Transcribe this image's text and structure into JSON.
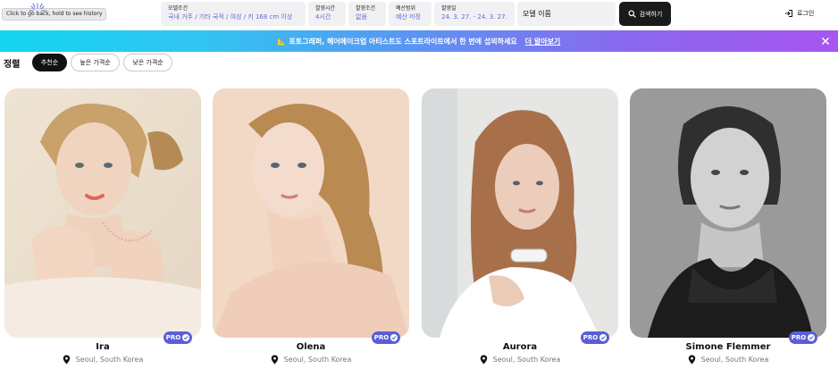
{
  "back_tooltip": "Click to go back, hold to see history",
  "filters": [
    {
      "label": "모델조건",
      "value": "국내 거주 / 기타 국적 / 여성 / 키 168 cm 이상"
    },
    {
      "label": "촬영시간",
      "value": "4시간"
    },
    {
      "label": "촬영조건",
      "value": "없음"
    },
    {
      "label": "예산범위",
      "value": "예산 미정"
    },
    {
      "label": "촬영일",
      "value": "24. 3. 27. - 24. 3. 27."
    }
  ],
  "search": {
    "value": "모델 이름",
    "button_label": "검색하기"
  },
  "login_label": "로그인",
  "banner": {
    "text": "📐 포토그래퍼, 헤어메이크업 아티스트도 스포트라이트에서 한 번에 섭외하세요",
    "link": "더 알아보기"
  },
  "sort": {
    "label": "정렬",
    "options": [
      "추천순",
      "높은 가격순",
      "낮은 가격순"
    ]
  },
  "models": [
    {
      "name": "Ira",
      "location": "Seoul, South Korea",
      "badge": "PRO"
    },
    {
      "name": "Olena",
      "location": "Seoul, South Korea",
      "badge": "PRO"
    },
    {
      "name": "Aurora",
      "location": "Seoul, South Korea",
      "badge": "PRO"
    },
    {
      "name": "Simone Flemmer",
      "location": "Seoul, South Korea",
      "badge": "PRO"
    }
  ],
  "colors": {
    "accent": "#5a5fd8",
    "filter_value": "#5b6bd6",
    "banner_start": "#13d6f0",
    "banner_end": "#a855f0"
  }
}
